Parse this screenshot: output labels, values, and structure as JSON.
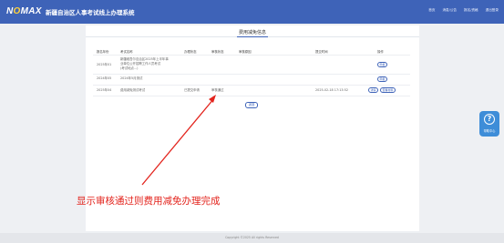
{
  "header": {
    "logo_text": "NOMAX",
    "title": "新疆自治区人事考试线上办理系统",
    "nav": [
      "首页",
      "消息/公告",
      "报名/资格",
      "退出登录"
    ]
  },
  "card": {
    "title": "费用减免信息"
  },
  "table": {
    "columns": [
      "报名年份",
      "考试名称",
      "办理状态",
      "审核状态",
      "审核原因",
      "提交时间",
      "操作"
    ],
    "rows": [
      {
        "year": "2025年01",
        "exam_lines": [
          "新疆维吾尔自治区2025年上半年事",
          "业单位公开招聘工作人员考试",
          "(考试地点...)"
        ],
        "status": "",
        "audit": "",
        "reason": "",
        "time": "",
        "actions": [
          "申报"
        ]
      },
      {
        "year": "2024年05",
        "exam_lines": [
          "2024年5月测试"
        ],
        "status": "",
        "audit": "",
        "reason": "",
        "time": "",
        "actions": [
          "申报"
        ]
      },
      {
        "year": "2025年04",
        "exam_lines": [
          "费用减免测试考试"
        ],
        "status": "已提交申请",
        "audit": "审核通过",
        "reason": "",
        "time": "2025-02-18 17:13:52",
        "actions": [
          "详情",
          "查看材料"
        ]
      }
    ]
  },
  "back_button": "返回",
  "float_help": {
    "icon": "help-icon",
    "label": "帮助中心"
  },
  "annotation": "显示审核通过则费用减免办理完成",
  "footer": "Copyright ©2025 All rights Reserved",
  "colors": {
    "header": "#3e63b8",
    "accent": "#3e63b8",
    "annotation": "#e3241d",
    "help": "#3e8dd8"
  }
}
